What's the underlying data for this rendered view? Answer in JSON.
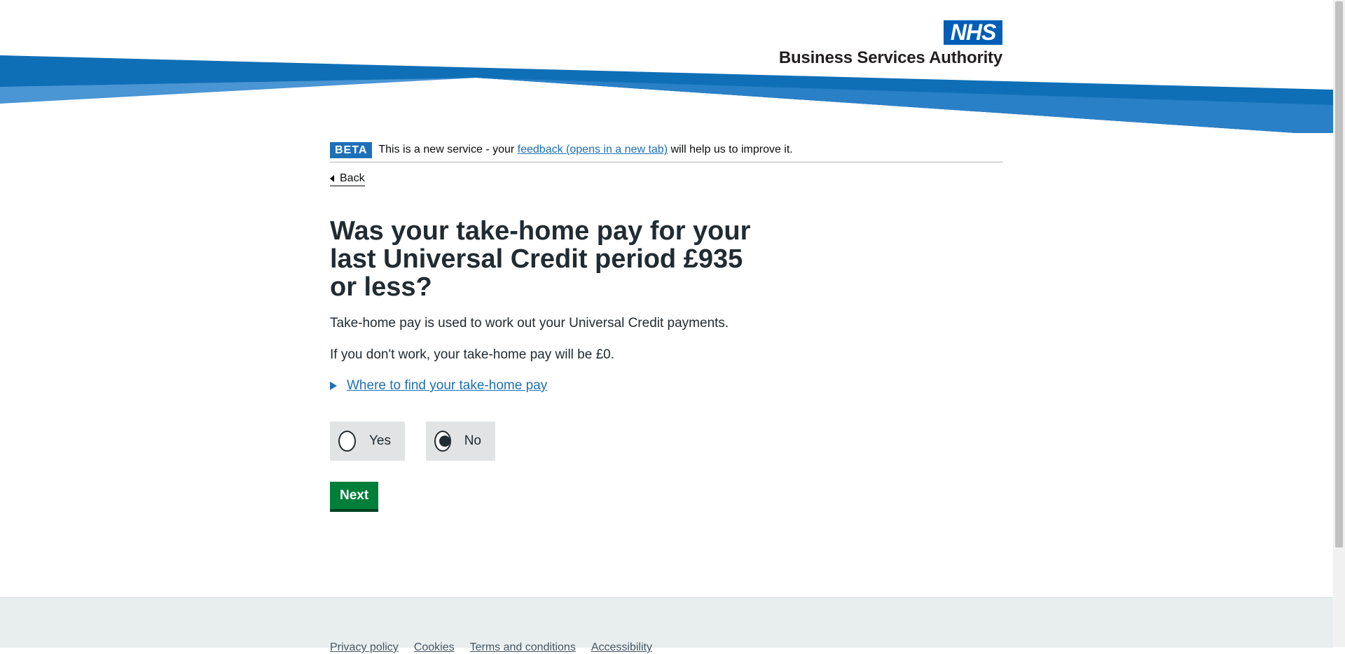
{
  "header": {
    "logo_nhs": "NHS",
    "logo_org": "Business Services Authority"
  },
  "phase_banner": {
    "tag": "BETA",
    "text_before": "This is a new service - your ",
    "link": "feedback (opens in a new tab)",
    "text_after": " will help us to improve it."
  },
  "back_link": "Back",
  "question": {
    "heading": "Was your take-home pay for your last Universal Credit period £935 or less?",
    "paragraph_1": "Take-home pay is used to work out your Universal Credit payments.",
    "paragraph_2": "If you don't work, your take-home pay will be £0.",
    "details_summary": "Where to find your take-home pay"
  },
  "options": {
    "yes": "Yes",
    "no": "No",
    "selected": "No"
  },
  "next_button": "Next",
  "footer": {
    "links": [
      "Privacy policy",
      "Cookies",
      "Terms and conditions",
      "Accessibility"
    ]
  },
  "colors": {
    "nhs_blue": "#005eb8",
    "swoosh_dark": "#0f6fb6",
    "swoosh_light": "#4a95d3",
    "link": "#1d70b8",
    "button_green": "#007f3b",
    "radio_bg": "#e2e3e4",
    "footer_bg": "#e8edee"
  }
}
